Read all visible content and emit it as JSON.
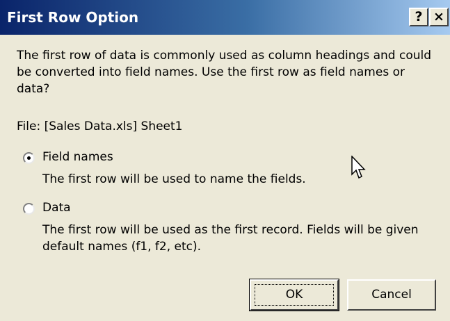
{
  "window": {
    "title": "First Row Option",
    "help_glyph": "?",
    "close_glyph": "×"
  },
  "content": {
    "intro": "The first row of data is commonly used as column headings and could be converted into field names. Use the first row as field names or data?",
    "file_label": "File: [Sales Data.xls] Sheet1"
  },
  "options": {
    "field_names": {
      "label": "Field names",
      "description": "The first row will be used to name the fields.",
      "selected": true
    },
    "data": {
      "label": "Data",
      "description": "The first row will be used as the first record. Fields will be given default names (f1, f2, etc).",
      "selected": false
    }
  },
  "buttons": {
    "ok_label": "OK",
    "cancel_label": "Cancel"
  },
  "colors": {
    "titlebar_start": "#0a246a",
    "titlebar_end": "#a6caf0",
    "dialog_bg": "#ece9d8"
  },
  "icons": {
    "cursor": "mouse-pointer-icon",
    "radio_selected": "radio-selected-icon",
    "radio_unselected": "radio-unselected-icon"
  }
}
